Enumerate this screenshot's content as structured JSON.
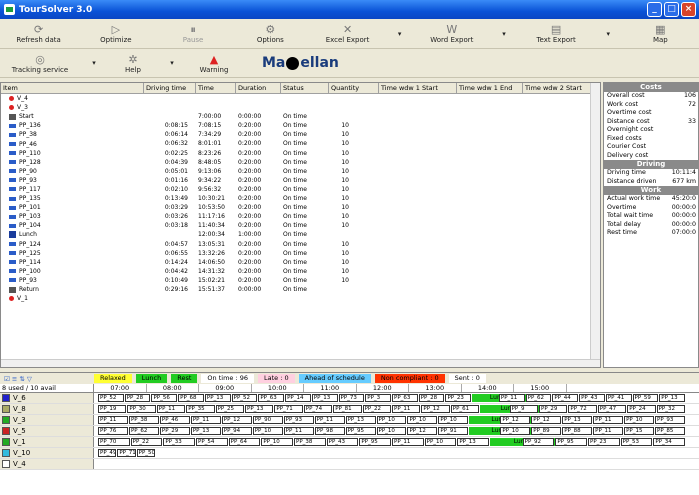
{
  "window": {
    "title": "TourSolver 3.0"
  },
  "toolbar1": [
    {
      "label": "Refresh data",
      "icon": "refresh-icon",
      "enabled": true
    },
    {
      "label": "Optimize",
      "icon": "play-icon",
      "enabled": true
    },
    {
      "label": "Pause",
      "icon": "pause-icon",
      "enabled": false
    },
    {
      "label": "Options",
      "icon": "options-icon",
      "enabled": true
    },
    {
      "label": "Excel Export",
      "icon": "excel-icon",
      "enabled": true
    },
    {
      "label": "Word Export",
      "icon": "word-icon",
      "enabled": true
    },
    {
      "label": "Text Export",
      "icon": "text-icon",
      "enabled": true
    },
    {
      "label": "Map",
      "icon": "map-icon",
      "enabled": true
    }
  ],
  "toolbar2": [
    {
      "label": "Tracking service",
      "icon": "tracking-icon"
    },
    {
      "label": "Help",
      "icon": "help-icon"
    },
    {
      "label": "Warning",
      "icon": "warning-icon"
    }
  ],
  "logo": {
    "text_a": "Ma",
    "text_b": "ellan",
    "tagline": "ingénierie"
  },
  "grid": {
    "columns": [
      "Item",
      "Driving time",
      "Time",
      "Duration",
      "Status",
      "Quantity",
      "Time wdw 1 Start",
      "Time wdw 1 End",
      "Time wdw 2 Start"
    ],
    "rows": [
      {
        "icon": "dot",
        "item": "V_4",
        "drv": "",
        "time": "",
        "dur": "",
        "stat": "",
        "qty": ""
      },
      {
        "icon": "dot",
        "item": "V_3",
        "drv": "",
        "time": "",
        "dur": "",
        "stat": "",
        "qty": ""
      },
      {
        "icon": "home",
        "item": "Start",
        "drv": "",
        "time": "7:00:00",
        "dur": "0:00:00",
        "stat": "On time",
        "qty": ""
      },
      {
        "icon": "truck",
        "item": "PP_136",
        "drv": "0:08:15",
        "time": "7:08:15",
        "dur": "0:20:00",
        "stat": "On time",
        "qty": "10"
      },
      {
        "icon": "truck",
        "item": "PP_38",
        "drv": "0:06:14",
        "time": "7:34:29",
        "dur": "0:20:00",
        "stat": "On time",
        "qty": "10"
      },
      {
        "icon": "truck",
        "item": "PP_46",
        "drv": "0:06:32",
        "time": "8:01:01",
        "dur": "0:20:00",
        "stat": "On time",
        "qty": "10"
      },
      {
        "icon": "truck",
        "item": "PP_110",
        "drv": "0:02:25",
        "time": "8:23:26",
        "dur": "0:20:00",
        "stat": "On time",
        "qty": "10"
      },
      {
        "icon": "truck",
        "item": "PP_128",
        "drv": "0:04:39",
        "time": "8:48:05",
        "dur": "0:20:00",
        "stat": "On time",
        "qty": "10"
      },
      {
        "icon": "truck",
        "item": "PP_90",
        "drv": "0:05:01",
        "time": "9:13:06",
        "dur": "0:20:00",
        "stat": "On time",
        "qty": "10"
      },
      {
        "icon": "truck",
        "item": "PP_93",
        "drv": "0:01:16",
        "time": "9:34:22",
        "dur": "0:20:00",
        "stat": "On time",
        "qty": "10"
      },
      {
        "icon": "truck",
        "item": "PP_117",
        "drv": "0:02:10",
        "time": "9:56:32",
        "dur": "0:20:00",
        "stat": "On time",
        "qty": "10"
      },
      {
        "icon": "truck",
        "item": "PP_135",
        "drv": "0:13:49",
        "time": "10:30:21",
        "dur": "0:20:00",
        "stat": "On time",
        "qty": "10"
      },
      {
        "icon": "truck",
        "item": "PP_101",
        "drv": "0:03:29",
        "time": "10:53:50",
        "dur": "0:20:00",
        "stat": "On time",
        "qty": "10"
      },
      {
        "icon": "truck",
        "item": "PP_103",
        "drv": "0:03:26",
        "time": "11:17:16",
        "dur": "0:20:00",
        "stat": "On time",
        "qty": "10"
      },
      {
        "icon": "truck",
        "item": "PP_104",
        "drv": "0:03:18",
        "time": "11:40:34",
        "dur": "0:20:00",
        "stat": "On time",
        "qty": "10"
      },
      {
        "icon": "lunch",
        "item": "Lunch",
        "drv": "",
        "time": "12:00:34",
        "dur": "1:00:00",
        "stat": "On time",
        "qty": ""
      },
      {
        "icon": "truck",
        "item": "PP_124",
        "drv": "0:04:57",
        "time": "13:05:31",
        "dur": "0:20:00",
        "stat": "On time",
        "qty": "10"
      },
      {
        "icon": "truck",
        "item": "PP_125",
        "drv": "0:06:55",
        "time": "13:32:26",
        "dur": "0:20:00",
        "stat": "On time",
        "qty": "10"
      },
      {
        "icon": "truck",
        "item": "PP_114",
        "drv": "0:14:24",
        "time": "14:06:50",
        "dur": "0:20:00",
        "stat": "On time",
        "qty": "10"
      },
      {
        "icon": "truck",
        "item": "PP_100",
        "drv": "0:04:42",
        "time": "14:31:32",
        "dur": "0:20:00",
        "stat": "On time",
        "qty": "10"
      },
      {
        "icon": "truck",
        "item": "PP_93",
        "drv": "0:10:49",
        "time": "15:02:21",
        "dur": "0:20:00",
        "stat": "On time",
        "qty": "10"
      },
      {
        "icon": "home",
        "item": "Return",
        "drv": "0:29:16",
        "time": "15:51:37",
        "dur": "0:00:00",
        "stat": "On time",
        "qty": ""
      },
      {
        "icon": "dot",
        "item": "V_1",
        "drv": "",
        "time": "",
        "dur": "",
        "stat": "",
        "qty": ""
      }
    ]
  },
  "summary": {
    "costs_title": "Costs",
    "costs": [
      [
        "Overall cost",
        "106"
      ],
      [
        "Work cost",
        "72"
      ],
      [
        "Overtime cost",
        ""
      ],
      [
        "Distance cost",
        "33"
      ],
      [
        "Overnight cost",
        ""
      ],
      [
        "Fixed costs",
        ""
      ],
      [
        "Courier Cost",
        ""
      ],
      [
        "Delivery cost",
        ""
      ]
    ],
    "driving_title": "Driving",
    "driving": [
      [
        "Driving time",
        "10:11:4"
      ],
      [
        "Distance driven",
        "677 km"
      ]
    ],
    "work_title": "Work",
    "work": [
      [
        "Actual work time",
        "45:20:0"
      ],
      [
        "Overtime",
        "00:00:0"
      ],
      [
        "Total wait time",
        "00:00:0"
      ],
      [
        "Total delay",
        "00:00:0"
      ],
      [
        "Rest time",
        "07:00:0"
      ]
    ]
  },
  "gantt": {
    "legend": [
      {
        "label": "Relaxed",
        "color": "#ffff33"
      },
      {
        "label": "Lunch",
        "color": "#22cc22"
      },
      {
        "label": "Rest",
        "color": "#22cc22"
      },
      {
        "label": "On time : 96",
        "color": "#ffffff"
      },
      {
        "label": "Late : 0",
        "color": "#ffd0e0"
      },
      {
        "label": "Ahead of schedule",
        "color": "#66ccff"
      },
      {
        "label": "Non compliant : 0",
        "color": "#ff3300"
      },
      {
        "label": "Sent : 0",
        "color": "#ffffff"
      }
    ],
    "used": "8 used / 10 avail",
    "hours": [
      "07:00",
      "08:00",
      "09:00",
      "10:00",
      "11:00",
      "12:00",
      "13:00",
      "14:00",
      "15:00"
    ],
    "vehicles": [
      {
        "name": "V_6",
        "color": "#2222cc",
        "blocks": [
          "PP_52",
          "PP_28",
          "PP_56",
          "PP_68",
          "PP_13",
          "PP_52",
          "PP_63",
          "PP_14",
          "PP_13",
          "PP_73",
          "PP_3",
          "PP_63",
          "PP_28",
          "PP_23",
          "",
          "PP_11",
          "PP_62",
          "PP_44",
          "PP_43",
          "PP_41",
          "PP_59",
          "PP_13"
        ],
        "lunch": 0.5
      },
      {
        "name": "V_8",
        "color": "#aaaa66",
        "blocks": [
          "PP_19",
          "PP_30",
          "PP_11",
          "PP_35",
          "PP_25",
          "PP_13",
          "PP_71",
          "PP_74",
          "PP_81",
          "PP_22",
          "PP_11",
          "PP_12",
          "PP_61",
          "",
          "PP_9",
          "PP_29",
          "PP_72",
          "PP_47",
          "PP_24",
          "PP_32"
        ],
        "lunch": 0.52
      },
      {
        "name": "V_3",
        "color": "#22aa22",
        "blocks": [
          "PP_11",
          "PP_38",
          "PP_46",
          "PP_11",
          "PP_12",
          "PP_90",
          "PP_93",
          "PP_11",
          "PP_13",
          "PP_10",
          "PP_10",
          "PP_10",
          "",
          "PP_12",
          "PP_12",
          "PP_13",
          "PP_11",
          "PP_10",
          "PP_93"
        ],
        "lunch": 0.54
      },
      {
        "name": "V_5",
        "color": "#cc2222",
        "blocks": [
          "PP_76",
          "PP_62",
          "PP_29",
          "PP_13",
          "PP_94",
          "PP_10",
          "PP_11",
          "PP_98",
          "PP_95",
          "PP_10",
          "PP_12",
          "PP_91",
          "",
          "PP_10",
          "PP_89",
          "PP_88",
          "PP_11",
          "PP_15",
          "PP_85"
        ],
        "lunch": 0.55
      },
      {
        "name": "V_1",
        "color": "#22aa22",
        "blocks": [
          "PP_70",
          "PP_22",
          "PP_33",
          "PP_54",
          "PP_64",
          "PP_10",
          "PP_38",
          "PP_43",
          "PP_95",
          "PP_11",
          "PP_10",
          "PP_13",
          "",
          "PP_92",
          "PP_95",
          "PP_23",
          "PP_53",
          "PP_34"
        ],
        "lunch": 0.53
      },
      {
        "name": "V_10",
        "color": "#33bbdd",
        "blocks": [
          "PP_49",
          "PP_71",
          "PP_50"
        ],
        "lunch": null
      },
      {
        "name": "V_4",
        "color": "#ffffff",
        "blocks": [],
        "lunch": null
      }
    ]
  }
}
